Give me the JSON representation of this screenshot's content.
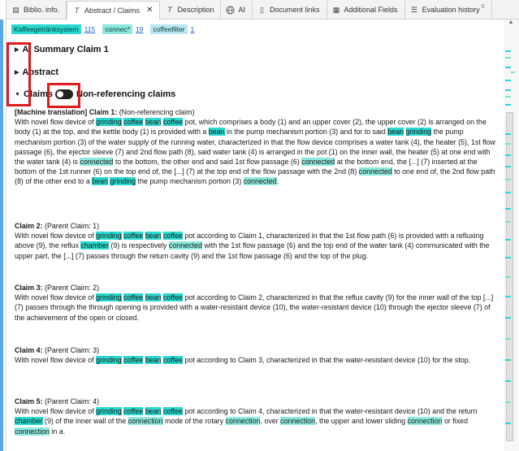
{
  "tabs": [
    {
      "label": "Biblio. info.",
      "icon": "book-icon",
      "active": false
    },
    {
      "label": "Abstract / Claims",
      "icon": "text-icon",
      "active": true,
      "close": "✕"
    },
    {
      "label": "Description",
      "icon": "text-icon",
      "active": false
    },
    {
      "label": "AI",
      "icon": "ai-globe-icon",
      "active": false
    },
    {
      "label": "Document links",
      "icon": "document-icon",
      "active": false
    },
    {
      "label": "Additional Fields",
      "icon": "grid-icon",
      "active": false
    },
    {
      "label": "Evaluation history",
      "icon": "list-icon",
      "active": false,
      "badge": "0"
    }
  ],
  "filters": [
    {
      "term": "Kaffeegetränksystem",
      "count": "115"
    },
    {
      "term": "connec*",
      "count": "19"
    },
    {
      "term": "coffeefilter",
      "count": "1"
    }
  ],
  "sections": {
    "summary": "AI Summary Claim 1",
    "abstract": "Abstract",
    "claims": "Claims",
    "non_ref": "Non-referencing claims"
  },
  "claim1": {
    "label": "[Machine translation] Claim 1:",
    "kind": "(Non-referencing claim)"
  },
  "claims": [
    {
      "label": "Claim 2:",
      "parent": "(Parent Claim: 1)"
    },
    {
      "label": "Claim 3:",
      "parent": "(Parent Claim: 2)"
    },
    {
      "label": "Claim 4:",
      "parent": "(Parent Claim: 3)"
    },
    {
      "label": "Claim 5:",
      "parent": "(Parent Claim: 4)"
    }
  ],
  "colors": {
    "highlight": "#2ad9d0",
    "highlight_alt": "#8de8dd",
    "annotation": "#e0191e"
  }
}
